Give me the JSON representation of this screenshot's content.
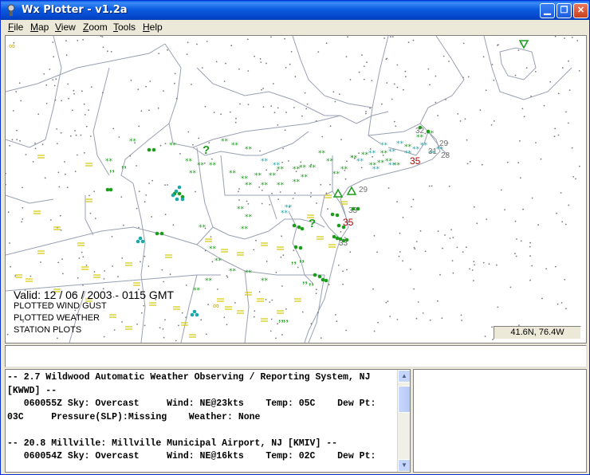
{
  "window": {
    "title": "Wx Plotter - v1.2a"
  },
  "menu": [
    {
      "first": "F",
      "rest": "ile"
    },
    {
      "first": "M",
      "rest": "ap"
    },
    {
      "first": "V",
      "rest": "iew"
    },
    {
      "first": "Z",
      "rest": "oom"
    },
    {
      "first": "T",
      "rest": "ools"
    },
    {
      "first": "H",
      "rest": "elp"
    }
  ],
  "map": {
    "valid_label": "Valid: 12 / 06 / 2003  -  0115 GMT",
    "overlays": [
      "PLOTTED WIND GUST",
      "PLOTTED WEATHER",
      "STATION PLOTS"
    ],
    "coordinates": "41.6N, 76.4W",
    "gust_values_red": [
      "35",
      "35"
    ],
    "gust_values_gray": [
      "32",
      "29",
      "31",
      "28",
      "29",
      "33",
      "33"
    ],
    "colors": {
      "rain": "#1a9e1a",
      "snow": "#1aa8a8",
      "gust_red": "#b00000",
      "gust_gray": "#707070",
      "fog": "#d8c800",
      "border": "#9aa0b4"
    }
  },
  "report": {
    "lines": [
      "-- 2.7 Wildwood Automatic Weather Observing / Reporting System, NJ",
      "[KWWD] --",
      "   060055Z Sky: Overcast     Wind: NE@23kts    Temp: 05C    Dew Pt:",
      "03C     Pressure(SLP):Missing    Weather: None",
      "",
      "-- 20.8 Millville: Millville Municipal Airport, NJ [KMIV] --",
      "   060054Z Sky: Overcast     Wind: NE@16kts    Temp: 02C    Dew Pt:"
    ]
  }
}
